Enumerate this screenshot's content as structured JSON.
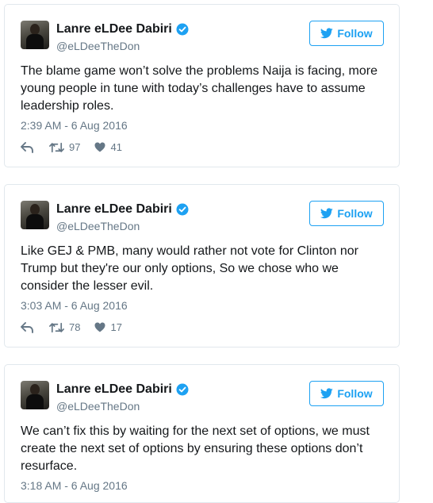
{
  "colors": {
    "accent": "#1da1f2",
    "text": "#14171a",
    "muted": "#657786",
    "border": "#e1e8ed"
  },
  "icons": [
    "verified-badge-icon",
    "twitter-bird-icon",
    "reply-icon",
    "retweet-icon",
    "heart-icon"
  ],
  "tweets": [
    {
      "name": "Lanre eLDee Dabiri",
      "handle": "@eLDeeTheDon",
      "follow_label": "Follow",
      "text": "The blame game won’t solve the problems Naija is facing, more young people in tune with today’s challenges have to assume leadership roles.",
      "time": "2:39 AM - 6 Aug 2016",
      "retweets": "97",
      "likes": "41"
    },
    {
      "name": "Lanre eLDee Dabiri",
      "handle": "@eLDeeTheDon",
      "follow_label": "Follow",
      "text": "Like GEJ & PMB, many would rather not vote for Clinton nor Trump but they're our only options, So we chose who we consider the lesser evil.",
      "time": "3:03 AM - 6 Aug 2016",
      "retweets": "78",
      "likes": "17"
    },
    {
      "name": "Lanre eLDee Dabiri",
      "handle": "@eLDeeTheDon",
      "follow_label": "Follow",
      "text": "We can’t fix this by waiting for the next set of options, we must create the next set of options by ensuring these options don’t resurface.",
      "time": "3:18 AM - 6 Aug 2016",
      "retweets": "",
      "likes": ""
    }
  ]
}
